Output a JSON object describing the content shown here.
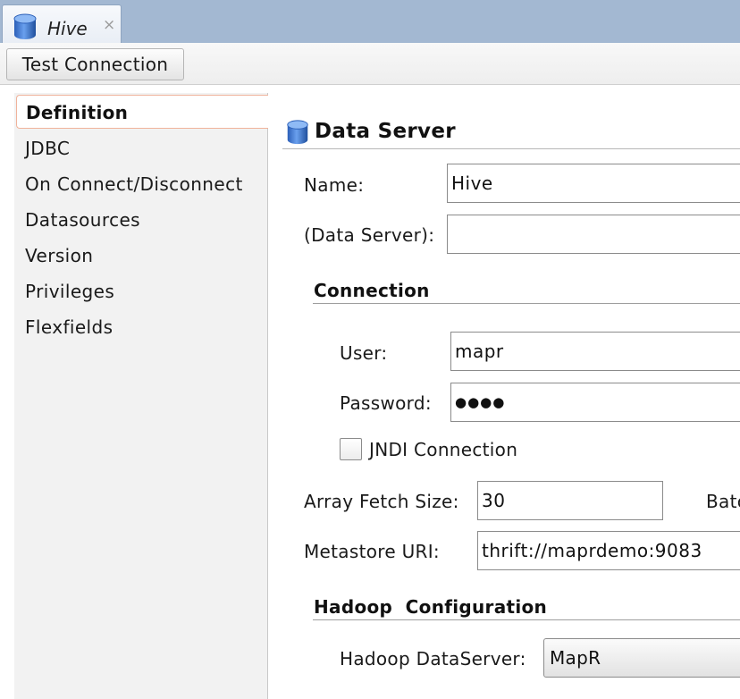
{
  "window": {
    "tab_title": "Hive",
    "tab_close_glyph": "×",
    "tab_icon": "database-icon"
  },
  "toolbar": {
    "test_connection_label": "Test Connection"
  },
  "nav": {
    "selected": "Definition",
    "items": [
      "Definition",
      "JDBC",
      "On Connect/Disconnect",
      "Datasources",
      "Version",
      "Privileges",
      "Flexfields"
    ]
  },
  "content": {
    "section_title": "Data Server",
    "section_icon": "database-icon",
    "name_label": "Name:",
    "name_value": "Hive",
    "data_server_label": "(Data Server):",
    "data_server_value": "",
    "connection_heading": "Connection",
    "user_label": "User:",
    "user_value": "mapr",
    "password_label": "Password:",
    "password_value": "●●●●",
    "jndi_label": "JNDI Connection",
    "jndi_checked": false,
    "array_fetch_label": "Array Fetch Size:",
    "array_fetch_value": "30",
    "batch_label_partial": "Batc",
    "metastore_label": "Metastore URI:",
    "metastore_value": "thrift://maprdemo:9083",
    "hadoop_heading": "Hadoop  Configuration",
    "hadoop_ds_label": "Hadoop DataServer:",
    "hadoop_ds_value": "MapR"
  },
  "colors": {
    "tabstrip": "#a3b8d2",
    "selected_border": "#f0b39b",
    "leftpanel": "#f2f2f2"
  }
}
